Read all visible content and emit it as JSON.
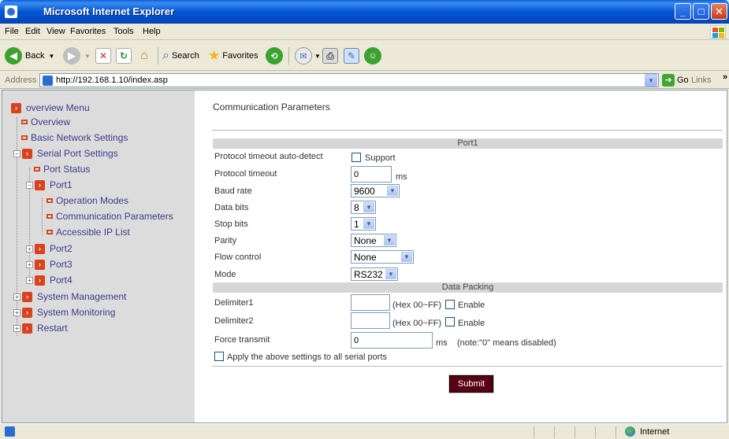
{
  "window": {
    "title": "Microsoft Internet Explorer"
  },
  "menu": [
    "File",
    "Edit",
    "View",
    "Favorites",
    "Tools",
    "Help"
  ],
  "toolbar": {
    "back": "Back",
    "search": "Search",
    "favorites": "Favorites"
  },
  "address": {
    "label": "Address",
    "url": "http://192.168.1.10/index.asp",
    "go": "Go",
    "links": "Links",
    "more": "»"
  },
  "sidebar": {
    "root": "overview Menu",
    "items": [
      {
        "label": "Overview"
      },
      {
        "label": "Basic Network Settings"
      },
      {
        "label": "Serial Port Settings"
      },
      {
        "label": "Port Status"
      },
      {
        "label": "Port1"
      },
      {
        "label": "Operation Modes"
      },
      {
        "label": "Communication Parameters"
      },
      {
        "label": "Accessible IP List"
      },
      {
        "label": "Port2"
      },
      {
        "label": "Port3"
      },
      {
        "label": "Port4"
      },
      {
        "label": "System Management"
      },
      {
        "label": "System Monitoring"
      },
      {
        "label": "Restart"
      }
    ]
  },
  "main": {
    "title": "Communication Parameters",
    "port_header": "Port1",
    "packing_header": "Data Packing",
    "fields": {
      "timeout_auto": {
        "label": "Protocol timeout auto-detect",
        "checkbox_label": "Support"
      },
      "timeout": {
        "label": "Protocol timeout",
        "value": "0",
        "unit": "ms"
      },
      "baud": {
        "label": "Baud rate",
        "value": "9600"
      },
      "databits": {
        "label": "Data bits",
        "value": "8"
      },
      "stopbits": {
        "label": "Stop bits",
        "value": "1"
      },
      "parity": {
        "label": "Parity",
        "value": "None"
      },
      "flow": {
        "label": "Flow control",
        "value": "None"
      },
      "mode": {
        "label": "Mode",
        "value": "RS232"
      },
      "delim1": {
        "label": "Delimiter1",
        "value": "",
        "hint": "(Hex 00~FF)",
        "enable": "Enable"
      },
      "delim2": {
        "label": "Delimiter2",
        "value": "",
        "hint": "(Hex 00~FF)",
        "enable": "Enable"
      },
      "force": {
        "label": "Force transmit",
        "value": "0",
        "unit": "ms",
        "note": "(note:\"0\" means disabled)"
      },
      "apply_all": "Apply the above settings to all serial ports"
    },
    "submit": "Submit"
  },
  "status": {
    "zone": "Internet"
  },
  "colors": {
    "sidebar_bg": "#dcdcdc",
    "tree_text": "#3c3c8c",
    "tree_icon": "#d8421e",
    "submit_bg": "#5a0012",
    "titlebar": "#0454d2"
  }
}
